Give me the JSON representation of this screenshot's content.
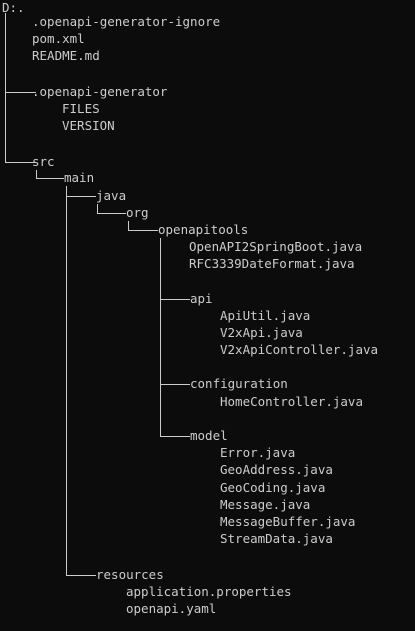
{
  "window": {
    "background": "#0c0c0c",
    "text_color": "#cccccc"
  },
  "tree": {
    "root_label": "D:.",
    "items": [
      ".openapi-generator-ignore",
      "pom.xml",
      "README.md",
      ".openapi-generator",
      "FILES",
      "VERSION",
      "src",
      "main",
      "java",
      "org",
      "openapitools",
      "OpenAPI2SpringBoot.java",
      "RFC3339DateFormat.java",
      "api",
      "ApiUtil.java",
      "V2xApi.java",
      "V2xApiController.java",
      "configuration",
      "HomeController.java",
      "model",
      "Error.java",
      "GeoAddress.java",
      "GeoCoding.java",
      "Message.java",
      "MessageBuffer.java",
      "StreamData.java",
      "resources",
      "application.properties",
      "openapi.yaml"
    ]
  }
}
